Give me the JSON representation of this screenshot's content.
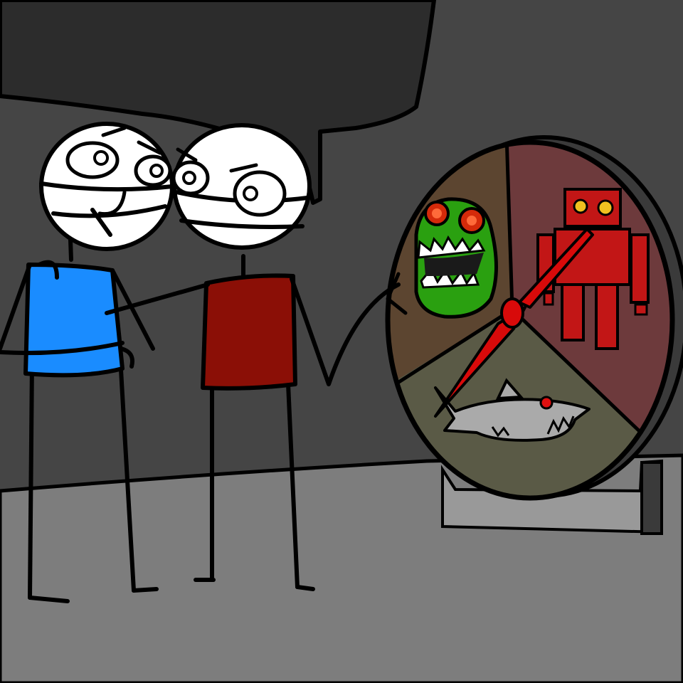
{
  "scene": {
    "colors": {
      "wall": "#454545",
      "ceiling_shadow": "#2c2c2c",
      "floor": "#7d7d7d",
      "outline": "#000000",
      "skin": "#ffffff",
      "shirt_left": "#1a8cff",
      "shirt_right": "#8b0f06",
      "wheel_rim": "#3a3a3a",
      "stand": "#999999",
      "segment_monster": "#5c4530",
      "segment_robot": "#6d3a3c",
      "segment_shark": "#5a5a46",
      "monster": "#2aa010",
      "monster_eye": "#d52a0a",
      "robot": "#c21616",
      "robot_eye": "#f0c020",
      "shark": "#aaaaaa",
      "shark_eye": "#e01010",
      "pointer": "#d80a0a"
    },
    "wheel": {
      "segments": [
        "monster",
        "robot",
        "shark"
      ],
      "pointer_icon": "spinner-pointer"
    },
    "characters": [
      "stick-figure-blue-shirt",
      "stick-figure-red-shirt"
    ]
  }
}
